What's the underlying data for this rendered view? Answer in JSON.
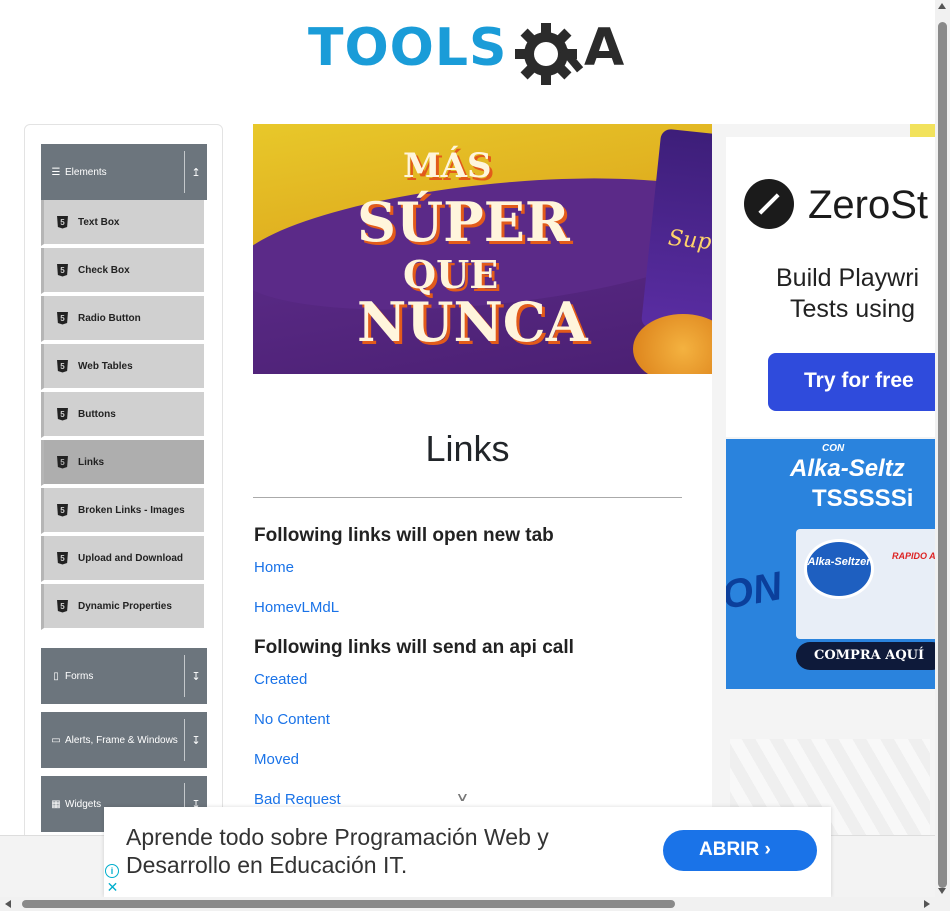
{
  "header": {
    "logo_text": "TOOLS",
    "logo_suffix": "A"
  },
  "sidebar": {
    "groups": [
      {
        "label": "Elements",
        "icon": "list-icon",
        "arrow": "↥"
      },
      {
        "label": "Forms",
        "icon": "doc-icon",
        "arrow": "↧"
      },
      {
        "label": "Alerts, Frame & Windows",
        "icon": "window-icon",
        "arrow": "↧"
      },
      {
        "label": "Widgets",
        "icon": "grid-icon",
        "arrow": "↧"
      }
    ],
    "items": [
      {
        "label": "Text Box"
      },
      {
        "label": "Check Box"
      },
      {
        "label": "Radio Button"
      },
      {
        "label": "Web Tables"
      },
      {
        "label": "Buttons"
      },
      {
        "label": "Links",
        "active": true
      },
      {
        "label": "Broken Links - Images"
      },
      {
        "label": "Upload and Download"
      },
      {
        "label": "Dynamic Properties"
      }
    ]
  },
  "banner": {
    "line1": "MÁS",
    "line2": "SÚPER",
    "line3": "QUE",
    "line4": "NUNCA",
    "bag_text": "Sup"
  },
  "right_ads": {
    "zero": {
      "name": "ZeroSt",
      "line1": "Build Playwri",
      "line2": "Tests using",
      "cta": "Try for free"
    },
    "alka": {
      "con": "CON",
      "brand1": "Alka-Seltz",
      "brand2": "TSSSSSi",
      "oval": "Alka-Seltzer",
      "rapido": "RAPIDO AL",
      "cta": "COMPRA AQUÍ",
      "on": "ON"
    }
  },
  "main": {
    "title": "Links",
    "section1": "Following links will open new tab",
    "links1": [
      "Home",
      "HomevLMdL"
    ],
    "section2": "Following links will send an api call",
    "links2": [
      "Created",
      "No Content",
      "Moved",
      "Bad Request"
    ]
  },
  "bottom_ad": {
    "text_line1": "Aprende todo sobre Programación Web y",
    "text_line2": "Desarrollo en Educación IT.",
    "cta": "ABRIR ›",
    "info": "i",
    "close": "✕"
  }
}
